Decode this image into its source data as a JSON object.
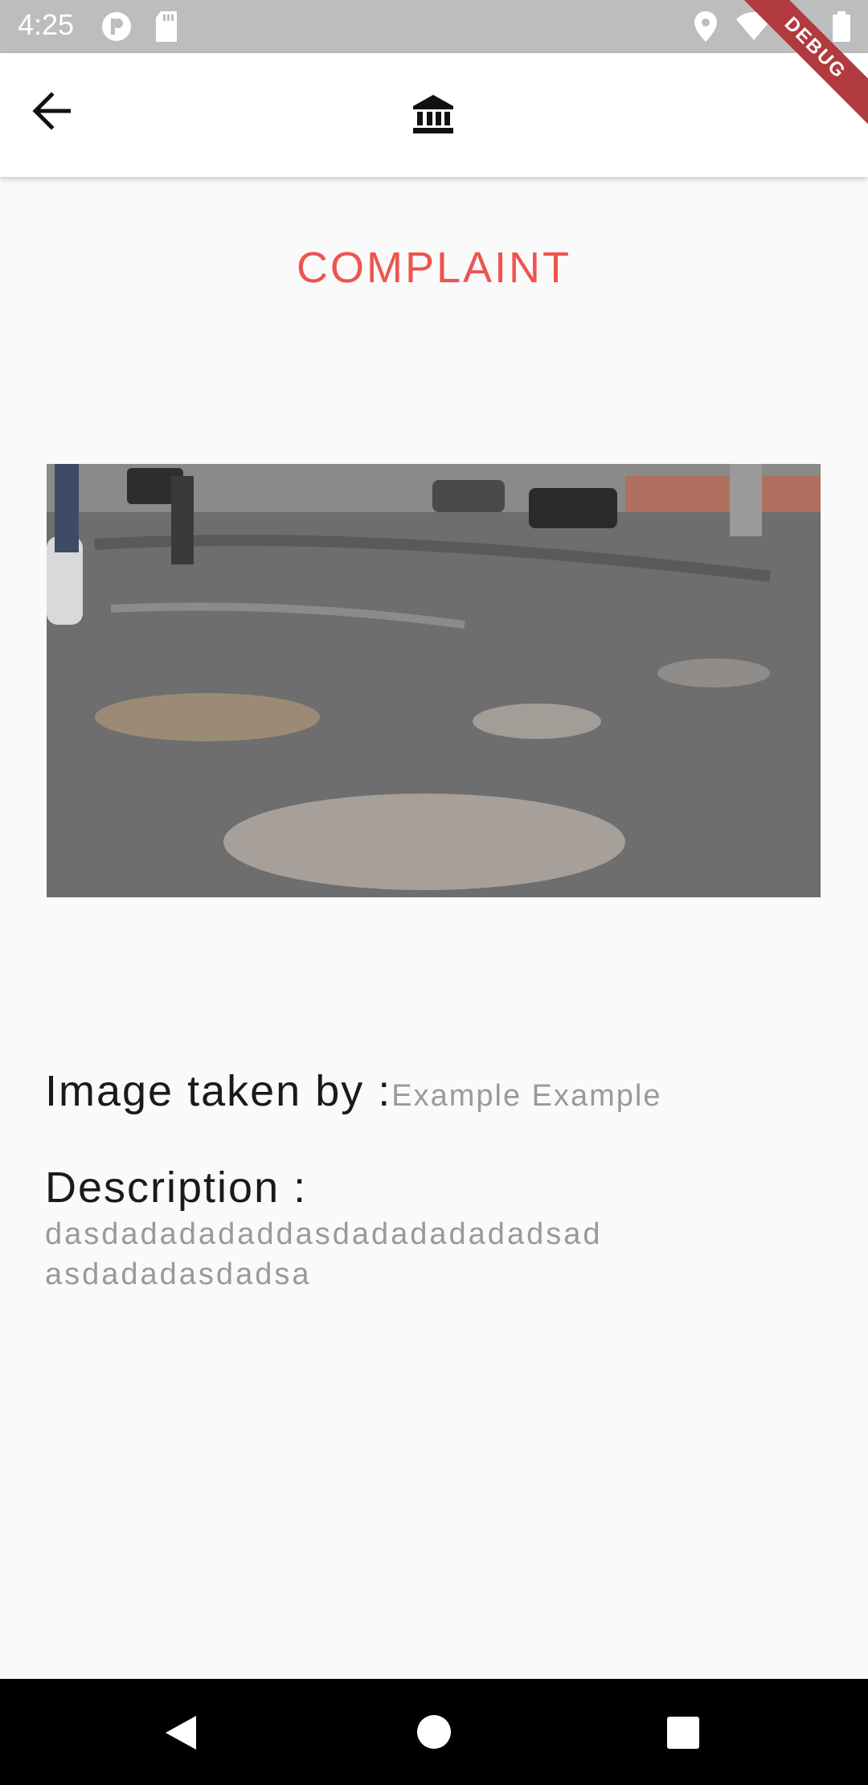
{
  "status_bar": {
    "time": "4:25",
    "icons": [
      "circle-p-icon",
      "sd-card-icon",
      "location-icon",
      "wifi-icon",
      "airplane-icon",
      "battery-icon"
    ]
  },
  "app_bar": {
    "back_icon": "arrow-left-icon",
    "logo_icon": "bank-icon"
  },
  "debug_banner": "DEBUG",
  "page": {
    "title": "COMPLAINT",
    "taken_by_label": "Image taken by :",
    "taken_by_value": "Example Example",
    "description_label": "Description :",
    "description_value": "dasdadadadaddasdadadadadadsadasdadadasdadsa"
  },
  "nav_bar": {
    "icons": [
      "back-triangle-icon",
      "home-circle-icon",
      "recents-square-icon"
    ]
  },
  "colors": {
    "title": "#ef5350",
    "status_bar": "#bdbdbd",
    "debug_banner": "#b03a3e"
  }
}
